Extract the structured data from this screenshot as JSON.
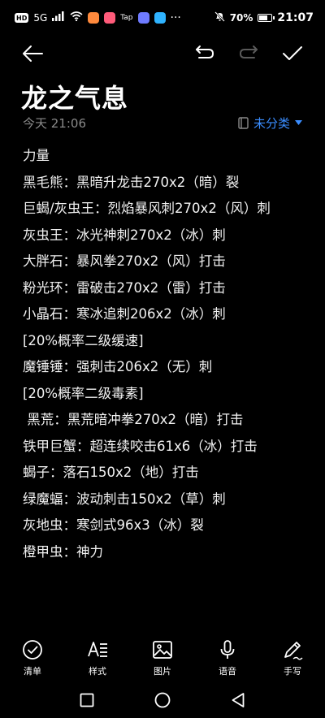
{
  "status_bar": {
    "left_badges": [
      "HD",
      "5G"
    ],
    "app_badges": [
      "Tap"
    ],
    "battery": "70%",
    "battery_level": 0.7,
    "time": "21:07"
  },
  "note": {
    "title": "龙之气息",
    "date": "今天 21:06",
    "category": "未分类",
    "lines": [
      "力量",
      "黑毛熊：黑暗升龙击270x2（暗）裂",
      "巨蝎/灰虫王：烈焰暴风刺270x2（风）刺",
      "灰虫王：冰光神刺270x2（冰）刺",
      "大胖石：暴风拳270x2（风）打击",
      "粉光环：雷破击270x2（雷）打击",
      "小晶石：寒冰追刺206x2（冰）刺",
      "[20%概率二级缓速]",
      "魔锤锤：强刺击206x2（无）刺",
      "[20%概率二级毒素]",
      " 黑荒：黑荒暗冲拳270x2（暗）打击",
      "铁甲巨蟹：超连续咬击61x6（冰）打击",
      "蝎子：落石150x2（地）打击",
      "绿魔蝠：波动刺击150x2（草）刺",
      "灰地虫：寒剑式96x3（冰）裂",
      "橙甲虫：神力"
    ]
  },
  "bottom_toolbar": {
    "checklist": "清单",
    "style": "样式",
    "image": "图片",
    "voice": "语音",
    "handwriting": "手写"
  },
  "colors": {
    "background": "#000000",
    "accent": "#3a8dff",
    "muted": "#8a8a8a"
  }
}
